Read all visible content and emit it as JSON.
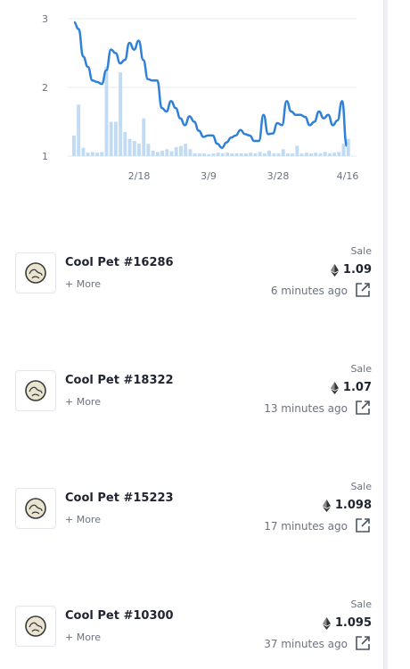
{
  "chart_data": {
    "type": "line",
    "x_ticks": [
      "2/18",
      "3/9",
      "3/28",
      "4/16"
    ],
    "y_ticks": [
      1,
      2,
      3
    ],
    "ylim": [
      1,
      3.1
    ],
    "grid": true,
    "series": [
      {
        "values": [
          2.95,
          2.85,
          2.45,
          2.3,
          2.1,
          2.08,
          2.05,
          2.25,
          2.55,
          2.5,
          2.35,
          2.4,
          2.65,
          2.55,
          2.68,
          2.4,
          2.12,
          2.1,
          2.1,
          1.7,
          1.65,
          1.8,
          1.7,
          1.55,
          1.45,
          1.58,
          1.5,
          1.37,
          1.28,
          1.3,
          1.3,
          1.18,
          1.12,
          1.2,
          1.27,
          1.3,
          1.38,
          1.32,
          1.3,
          1.22,
          1.22,
          1.6,
          1.32,
          1.33,
          1.48,
          1.45,
          1.8,
          1.65,
          1.6,
          1.6,
          1.57,
          1.45,
          1.5,
          1.65,
          1.55,
          1.6,
          1.45,
          1.52,
          1.8,
          1.15
        ]
      },
      {
        "type": "bar",
        "values": [
          1.3,
          1.75,
          1.12,
          1.05,
          1.06,
          1.05,
          1.06,
          2.3,
          1.5,
          1.5,
          2.22,
          1.35,
          1.25,
          1.22,
          1.18,
          1.55,
          1.18,
          1.08,
          1.06,
          1.08,
          1.1,
          1.07,
          1.13,
          1.15,
          1.18,
          1.1,
          1.04,
          1.04,
          1.04,
          1.03,
          1.04,
          1.05,
          1.04,
          1.05,
          1.04,
          1.04,
          1.04,
          1.04,
          1.05,
          1.04,
          1.06,
          1.04,
          1.08,
          1.04,
          1.04,
          1.1,
          1.04,
          1.04,
          1.15,
          1.04,
          1.05,
          1.04,
          1.05,
          1.04,
          1.06,
          1.04,
          1.05,
          1.06,
          1.18,
          1.25
        ]
      }
    ]
  },
  "sales": [
    {
      "name": "Cool Pet #16286",
      "more": "+ More",
      "event": "Sale",
      "price": "1.09",
      "time": "6 minutes ago"
    },
    {
      "name": "Cool Pet #18322",
      "more": "+ More",
      "event": "Sale",
      "price": "1.07",
      "time": "13 minutes ago"
    },
    {
      "name": "Cool Pet #15223",
      "more": "+ More",
      "event": "Sale",
      "price": "1.098",
      "time": "17 minutes ago"
    },
    {
      "name": "Cool Pet #10300",
      "more": "+ More",
      "event": "Sale",
      "price": "1.095",
      "time": "37 minutes ago"
    }
  ],
  "colors": {
    "line": "#2f80d8",
    "bars": "#c2dbf5",
    "grid": "#e6e8eb"
  },
  "icons": {
    "currency": "eth-icon",
    "thumbnail": "pet-egg-icon",
    "open": "external-link-icon"
  }
}
